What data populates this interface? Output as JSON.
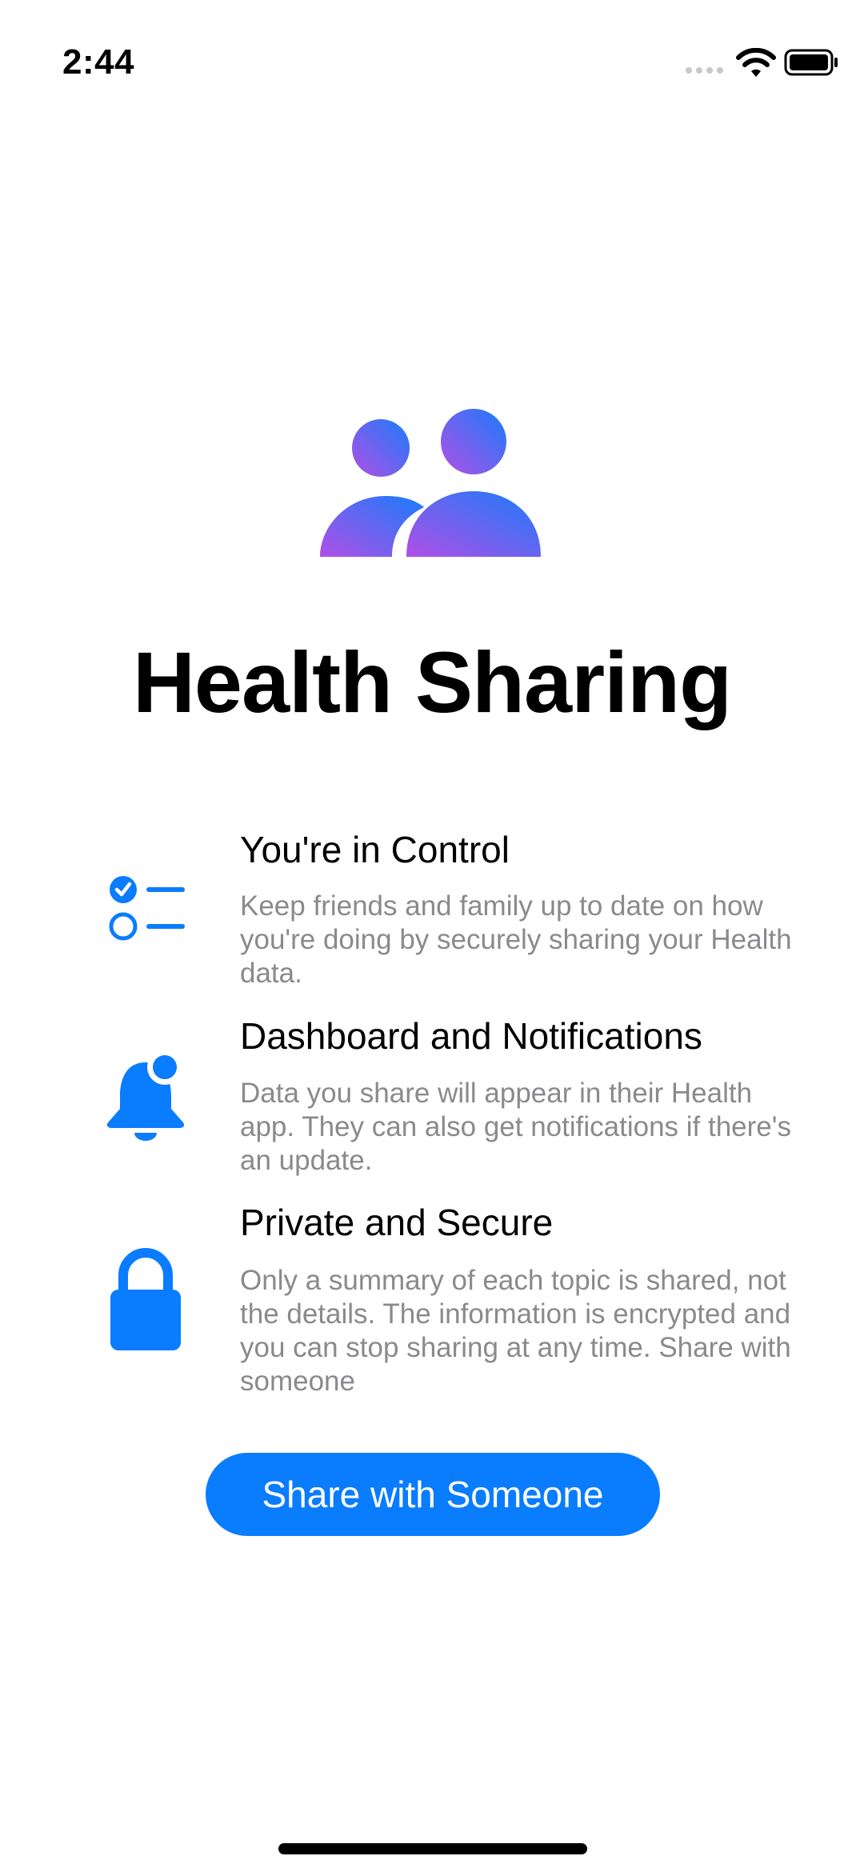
{
  "status_bar": {
    "time": "2:44",
    "icons": [
      "cellular-signal-icon",
      "wifi-icon",
      "battery-icon"
    ]
  },
  "hero": {
    "icon": "people-icon",
    "title": "Health Sharing"
  },
  "features": [
    {
      "icon": "checklist-icon",
      "heading": "You're in Control",
      "text": "Keep friends and family up to date on how you're doing by securely sharing your Health data."
    },
    {
      "icon": "bell-badge-icon",
      "heading": "Dashboard and Notifications",
      "text": "Data you share will appear in their Health app. They can also get notifications if there's an update."
    },
    {
      "icon": "lock-icon",
      "heading": "Private and Secure",
      "text": "Only a summary of each topic is shared, not the details. The information is encrypted and you can stop sharing at any time. Share with someone"
    }
  ],
  "primary_button": {
    "label": "Share with Someone"
  },
  "colors": {
    "accent": "#0a7cfe",
    "secondary_text": "#8a8a8e",
    "gradient_start": "#b04fe6",
    "gradient_end": "#1a7cfb"
  }
}
